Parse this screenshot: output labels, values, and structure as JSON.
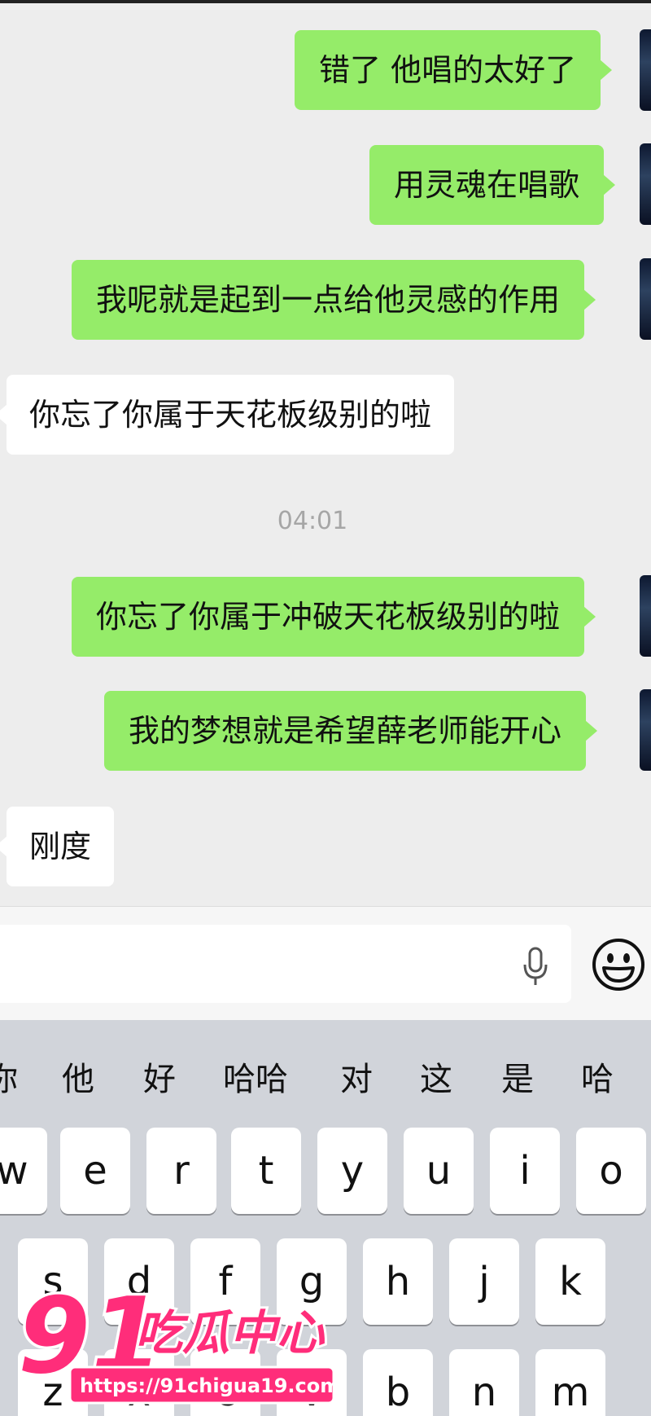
{
  "chat": {
    "messages": [
      {
        "side": "out",
        "text": "错了 他唱的太好了"
      },
      {
        "side": "out",
        "text": "用灵魂在唱歌"
      },
      {
        "side": "out",
        "text": "我呢就是起到一点给他灵感的作用"
      },
      {
        "side": "in",
        "text": "你忘了你属于天花板级别的啦"
      },
      {
        "side": "out",
        "text": "你忘了你属于冲破天花板级别的啦"
      },
      {
        "side": "out",
        "text": "我的梦想就是希望薛老师能开心"
      },
      {
        "side": "in",
        "text": "刚度"
      }
    ],
    "timestamp": "04:01"
  },
  "input": {
    "mic_icon": "microphone-icon",
    "emoji_icon": "smiley-icon"
  },
  "keyboard": {
    "candidates": [
      "你",
      "他",
      "好",
      "哈哈",
      "对",
      "这",
      "是",
      "哈"
    ],
    "row1": [
      "w",
      "e",
      "r",
      "t",
      "y",
      "u",
      "i",
      "o"
    ],
    "row2": [
      "s",
      "d",
      "f",
      "g",
      "h",
      "j",
      "k"
    ],
    "row3": [
      "z",
      "x",
      "c",
      "v",
      "b",
      "n",
      "m"
    ]
  },
  "watermark": {
    "number": "91",
    "name": "吃瓜中心",
    "url": "https://91chigua19.com"
  },
  "colors": {
    "outgoing_bubble": "#95ec69",
    "incoming_bubble": "#ffffff",
    "chat_background": "#ededed",
    "watermark_pink": "#ff2d7a"
  }
}
